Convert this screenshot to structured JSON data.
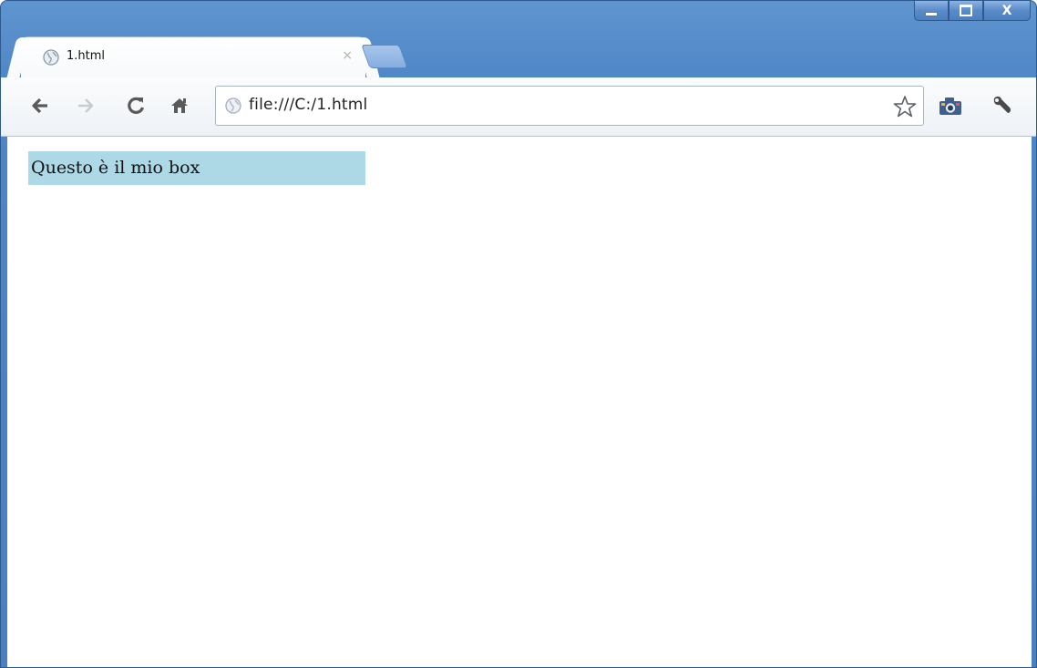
{
  "window": {
    "controls": {
      "minimize_icon": "minimize-icon",
      "maximize_icon": "maximize-icon",
      "close_label": "X"
    }
  },
  "tabs": [
    {
      "title": "1.html",
      "favicon": "globe-icon",
      "close_label": "×",
      "active": true
    }
  ],
  "toolbar": {
    "back_icon": "back-arrow-icon",
    "forward_icon": "forward-arrow-icon",
    "reload_icon": "reload-icon",
    "home_icon": "home-icon",
    "omnibox": {
      "url": "file:///C:/1.html",
      "icon": "globe-icon"
    },
    "bookmark_icon": "star-icon",
    "extension_icon": "camera-icon",
    "wrench_icon": "wrench-icon"
  },
  "page": {
    "box_text": "Questo è il mio box",
    "box_color": "#add8e6"
  },
  "colors": {
    "frame": "#4f86c6",
    "toolbar": "#f2f5f8",
    "content": "#ffffff"
  }
}
